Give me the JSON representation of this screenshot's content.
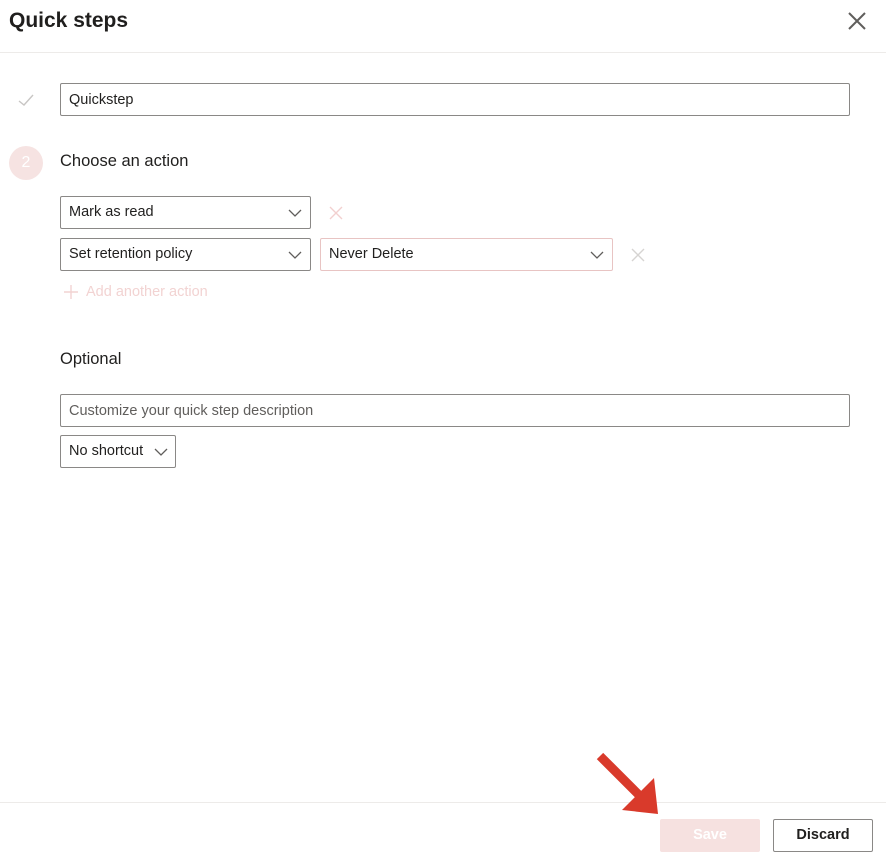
{
  "header": {
    "title": "Quick steps"
  },
  "step1": {
    "name_value": "Quickstep"
  },
  "step2": {
    "number": "2",
    "label": "Choose an action",
    "actions": [
      {
        "action": "Mark as read"
      },
      {
        "action": "Set retention policy",
        "option": "Never Delete"
      }
    ],
    "add_action_label": "Add another action"
  },
  "optional": {
    "label": "Optional",
    "description_placeholder": "Customize your quick step description",
    "shortcut_value": "No shortcut"
  },
  "footer": {
    "save_label": "Save",
    "discard_label": "Discard"
  },
  "colors": {
    "accent_disabled": "#f6e1e0",
    "annotation_arrow": "#d93a2b",
    "border": "#8a8886"
  },
  "icons": {
    "close": "close-icon",
    "check": "check-icon",
    "chevron": "chevron-down-icon",
    "remove": "dismiss-icon",
    "add": "add-icon",
    "annotation": "arrow-pointer-icon"
  }
}
